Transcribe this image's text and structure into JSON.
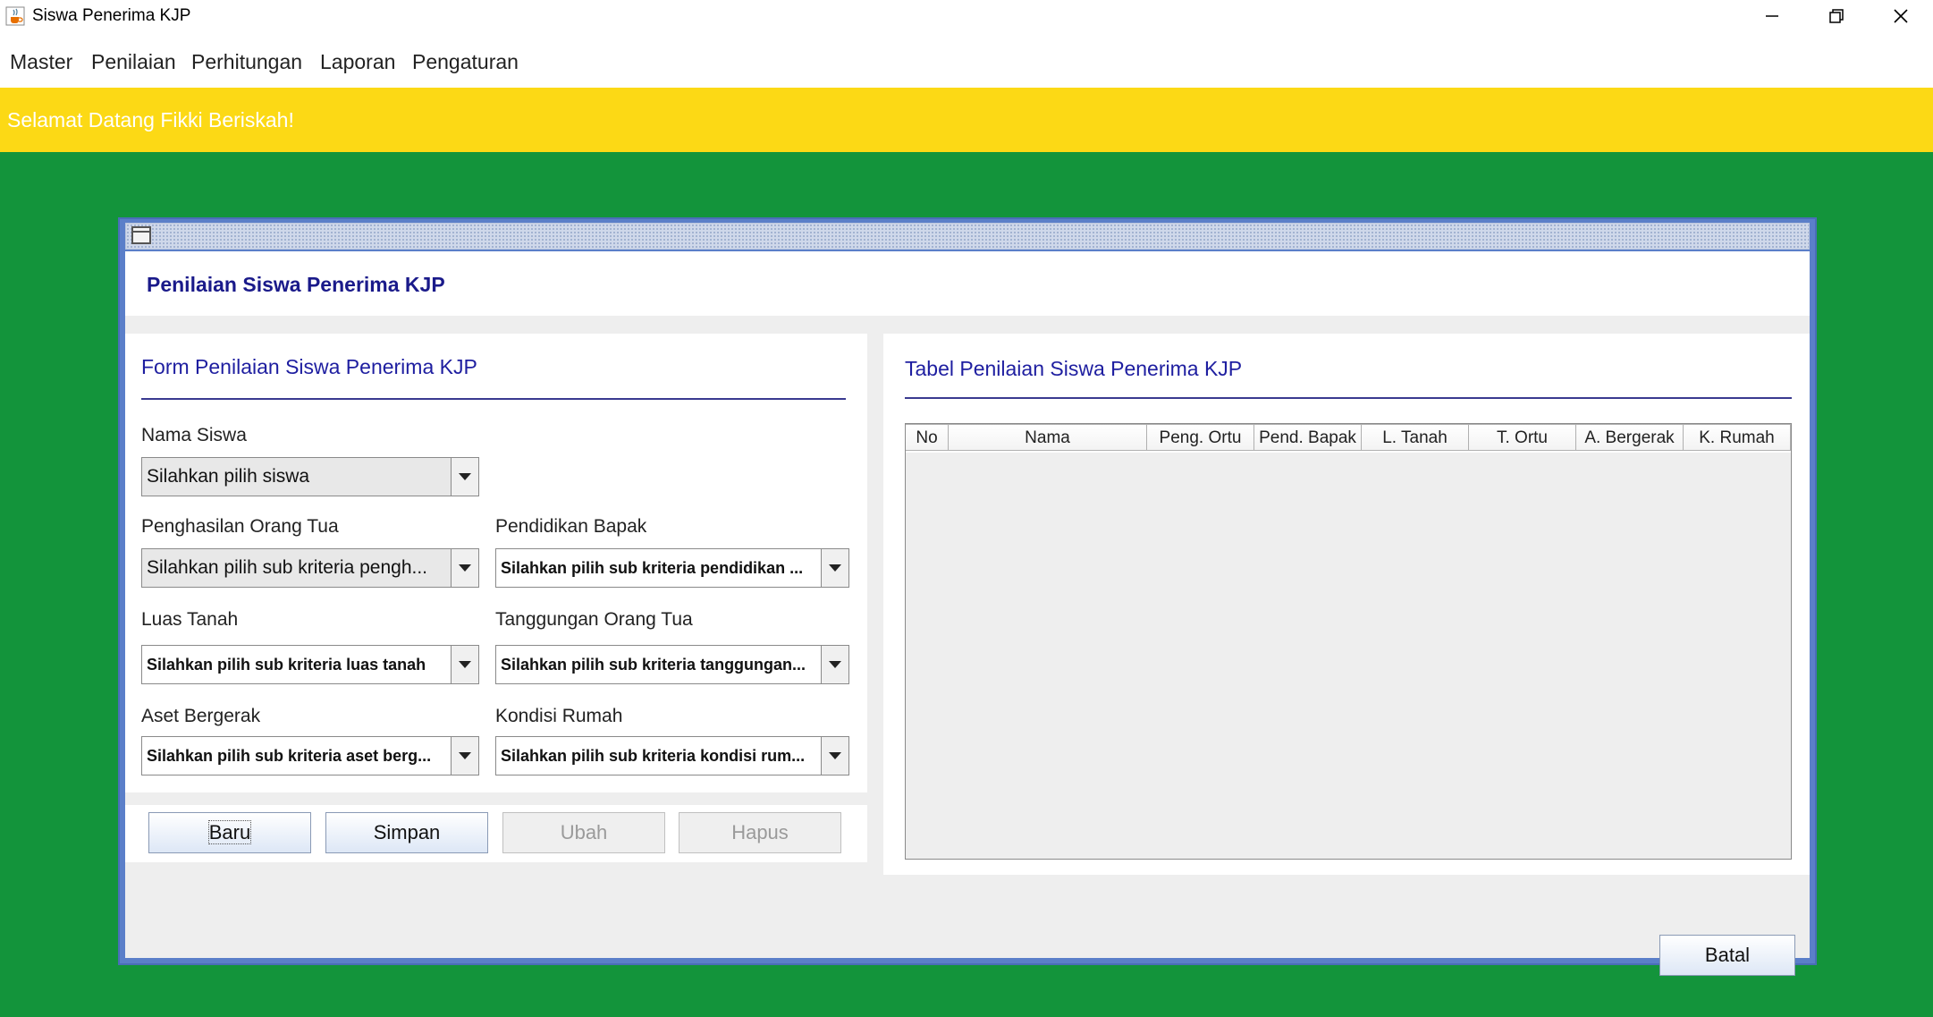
{
  "window": {
    "title": "Siswa Penerima KJP",
    "icons": {
      "app": "java-cup-icon",
      "minimize": "minimize-icon",
      "restore": "restore-icon",
      "close": "close-icon"
    }
  },
  "menu": [
    "Master",
    "Penilaian",
    "Perhitungan",
    "Laporan",
    "Pengaturan"
  ],
  "banner": {
    "text": "Selamat Datang Fikki Beriskah!",
    "color": "#fcd915"
  },
  "colors": {
    "background": "#13943b",
    "accent": "#1e1ea0"
  },
  "frame": {
    "title": "Penilaian Siswa Penerima KJP",
    "form": {
      "heading": "Form Penilaian Siswa Penerima KJP",
      "fields": {
        "nama_siswa": {
          "label": "Nama Siswa",
          "value": "Silahkan pilih siswa"
        },
        "penghasilan": {
          "label": "Penghasilan Orang Tua",
          "value": "Silahkan pilih sub kriteria pengh..."
        },
        "pendidikan": {
          "label": "Pendidikan Bapak",
          "value": "Silahkan pilih sub kriteria pendidikan ..."
        },
        "luas_tanah": {
          "label": "Luas Tanah",
          "value": "Silahkan pilih sub kriteria luas tanah"
        },
        "tanggungan": {
          "label": "Tanggungan Orang Tua",
          "value": "Silahkan pilih sub kriteria tanggungan..."
        },
        "aset": {
          "label": "Aset Bergerak",
          "value": "Silahkan pilih sub kriteria aset berg..."
        },
        "kondisi": {
          "label": "Kondisi Rumah",
          "value": "Silahkan pilih sub kriteria kondisi rum..."
        }
      },
      "buttons": {
        "baru": "Baru",
        "simpan": "Simpan",
        "ubah": "Ubah",
        "hapus": "Hapus"
      }
    },
    "table": {
      "heading": "Tabel Penilaian Siswa Penerima KJP",
      "columns": [
        "No",
        "Nama",
        "Peng. Ortu",
        "Pend. Bapak",
        "L. Tanah",
        "T. Ortu",
        "A. Bergerak",
        "K. Rumah"
      ],
      "rows": []
    },
    "batal": "Batal"
  }
}
